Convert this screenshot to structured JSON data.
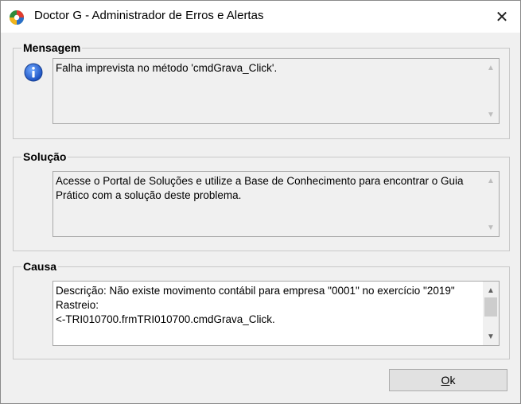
{
  "window": {
    "title": "Doctor G - Administrador de Erros e Alertas",
    "close_glyph": "✕"
  },
  "mensagem": {
    "label": "Mensagem",
    "text": "Falha imprevista no método 'cmdGrava_Click'."
  },
  "solucao": {
    "label": "Solução",
    "text": "Acesse o Portal de Soluções e utilize a Base de Conhecimento para encontrar o Guia Prático com a solução deste problema."
  },
  "causa": {
    "label": "Causa",
    "text": "Descrição: Não existe movimento contábil para empresa \"0001\" no exercício \"2019\"\nRastreio:\n<-TRI010700.frmTRI010700.cmdGrava_Click."
  },
  "ok_button": {
    "mnemonic": "O",
    "rest": "k"
  },
  "icons": {
    "app": "doctor-g-app-icon",
    "info": "info-icon"
  }
}
